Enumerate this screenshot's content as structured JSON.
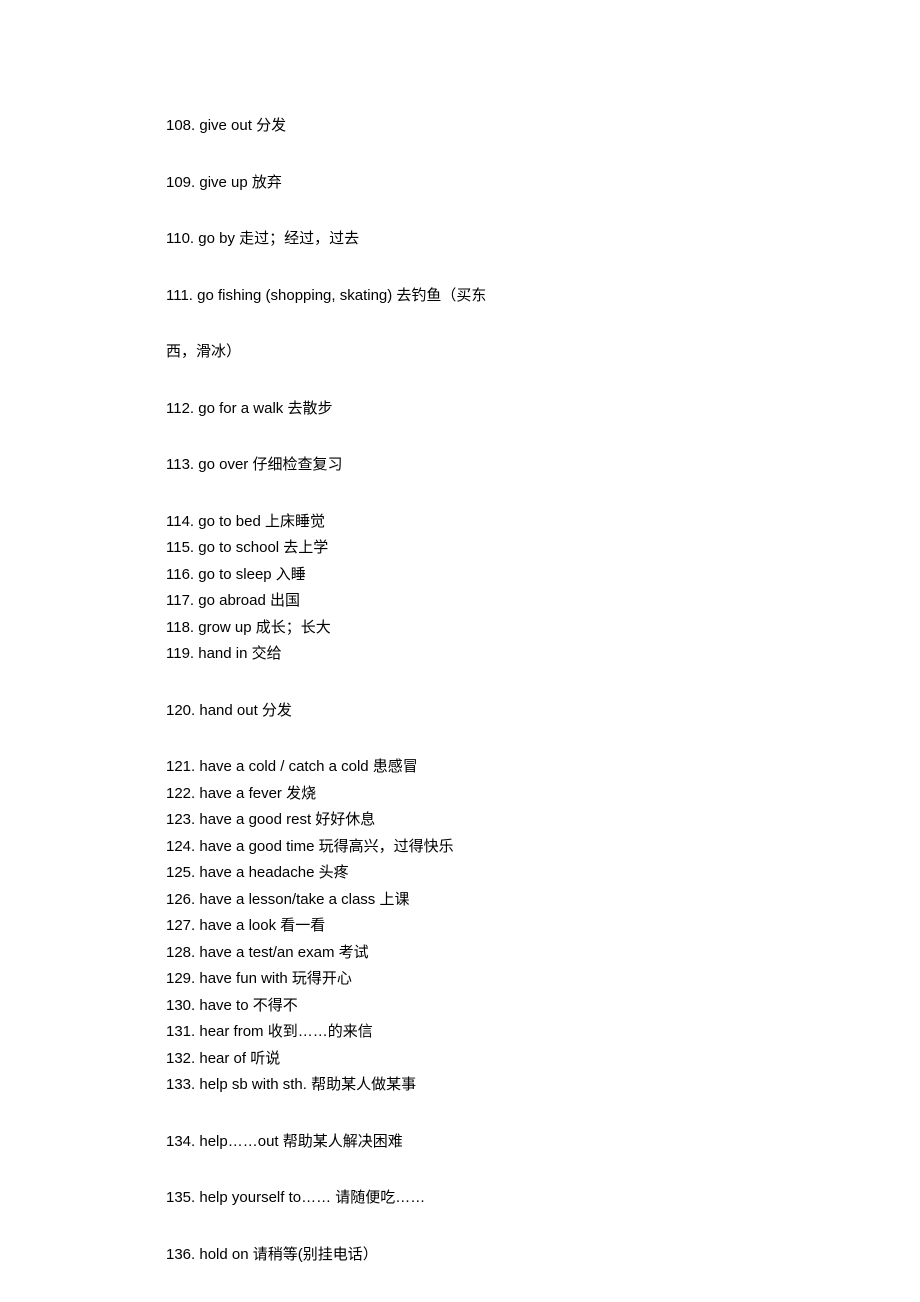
{
  "entries": [
    {
      "num": "108",
      "en": "give out",
      "zh": "分发",
      "spaced": true
    },
    {
      "num": "109",
      "en": "give up",
      "zh": "放弃",
      "spaced": true
    },
    {
      "num": "110",
      "en": "go by",
      "zh": "走过；经过，过去",
      "spaced": true
    },
    {
      "num": "111",
      "en": "go fishing (shopping, skating)",
      "zh": "去钓鱼（买东",
      "spaced": true,
      "continuation": "西，滑冰）"
    },
    {
      "num": "112",
      "en": "go for a walk",
      "zh": "去散步",
      "spaced": true
    },
    {
      "num": "113",
      "en": "go over",
      "zh": "仔细检查复习",
      "spaced": true
    },
    {
      "num": "114",
      "en": "go to bed",
      "zh": "上床睡觉",
      "spaced": false
    },
    {
      "num": "115",
      "en": "go to school",
      "zh": "去上学",
      "spaced": false
    },
    {
      "num": "116",
      "en": "go to sleep",
      "zh": "入睡",
      "spaced": false
    },
    {
      "num": "117",
      "en": "go abroad",
      "zh": "出国",
      "spaced": false
    },
    {
      "num": "118",
      "en": "grow up",
      "zh": "成长；长大",
      "spaced": false
    },
    {
      "num": "119",
      "en": "hand in",
      "zh": "交给",
      "spaced": true
    },
    {
      "num": "120",
      "en": "hand out",
      "zh": "分发",
      "spaced": true
    },
    {
      "num": "121",
      "en": "have a cold / catch a cold",
      "zh": "患感冒",
      "spaced": false
    },
    {
      "num": "122",
      "en": "have a fever",
      "zh": "发烧",
      "spaced": false
    },
    {
      "num": "123",
      "en": "have a good rest",
      "zh": "好好休息",
      "spaced": false
    },
    {
      "num": "124",
      "en": "have a good time",
      "zh": "玩得高兴，过得快乐",
      "spaced": false
    },
    {
      "num": "125",
      "en": "have a headache",
      "zh": "头疼",
      "spaced": false
    },
    {
      "num": "126",
      "en": "have a lesson/take a class",
      "zh": "上课",
      "spaced": false
    },
    {
      "num": "127",
      "en": "have a look",
      "zh": "看一看",
      "spaced": false
    },
    {
      "num": "128",
      "en": "have a test/an exam",
      "zh": "考试",
      "spaced": false
    },
    {
      "num": "129",
      "en": "have fun with",
      "zh": "玩得开心",
      "spaced": false
    },
    {
      "num": "130",
      "en": "have to",
      "zh": "不得不",
      "spaced": false
    },
    {
      "num": "131",
      "en": "hear from",
      "zh": "收到……的来信",
      "spaced": false
    },
    {
      "num": "132",
      "en": "hear of",
      "zh": "听说",
      "spaced": false
    },
    {
      "num": "133",
      "en": "help sb with sth.",
      "zh": "帮助某人做某事",
      "spaced": true
    },
    {
      "num": "134",
      "en": "help……out",
      "zh": "帮助某人解决困难",
      "spaced": true
    },
    {
      "num": "135",
      "en": "help yourself to……",
      "zh": "请随便吃……",
      "spaced": true
    },
    {
      "num": "136",
      "en": "hold on",
      "zh": "请稍等(别挂电话）",
      "spaced": true
    }
  ]
}
